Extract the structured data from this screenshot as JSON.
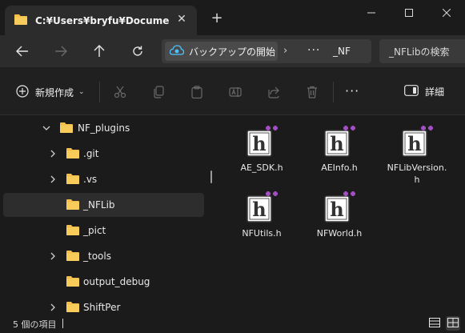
{
  "window": {
    "tab_title": "C:¥Users¥bryfu¥Documents¥A",
    "tab_close": "✕",
    "new_tab": "+"
  },
  "navigation": {
    "breadcrumb_start": "バックアップの開始",
    "breadcrumb_separator": "›",
    "breadcrumb_more": "···",
    "breadcrumb_current": "_NF",
    "search_placeholder": "_NFLibの検索"
  },
  "toolbar": {
    "new_label": "新規作成",
    "new_chevron": "⌄",
    "more_label": "···",
    "details_label": "詳細"
  },
  "sidebar": {
    "items": [
      {
        "label": "NF_plugins",
        "expanded": true,
        "level": 1
      },
      {
        "label": ".git",
        "expanded": false,
        "level": 2
      },
      {
        "label": ".vs",
        "expanded": false,
        "level": 2
      },
      {
        "label": "_NFLib",
        "selected": true,
        "level": 2
      },
      {
        "label": "_pict",
        "level": 2
      },
      {
        "label": "_tools",
        "expanded": false,
        "level": 2
      },
      {
        "label": "output_debug",
        "level": 2
      },
      {
        "label": "ShiftPer",
        "expanded": false,
        "level": 2
      }
    ]
  },
  "files": [
    {
      "name": "AE_SDK.h",
      "icon": "c-header-file-icon"
    },
    {
      "name": "AEInfo.h",
      "icon": "c-header-file-icon"
    },
    {
      "name": "NFLibVersion.h",
      "icon": "c-header-file-icon"
    },
    {
      "name": "NFUtils.h",
      "icon": "c-header-file-icon"
    },
    {
      "name": "NFWorld.h",
      "icon": "c-header-file-icon"
    }
  ],
  "status": {
    "item_count": "5 個の項目"
  },
  "colors": {
    "background": "#1b1b1b",
    "titlebar_tab": "#2c2c2c",
    "folder": "#f4c04a",
    "header_icon_accent": "#a64fc7",
    "accent_blue": "#4cc2ff"
  }
}
